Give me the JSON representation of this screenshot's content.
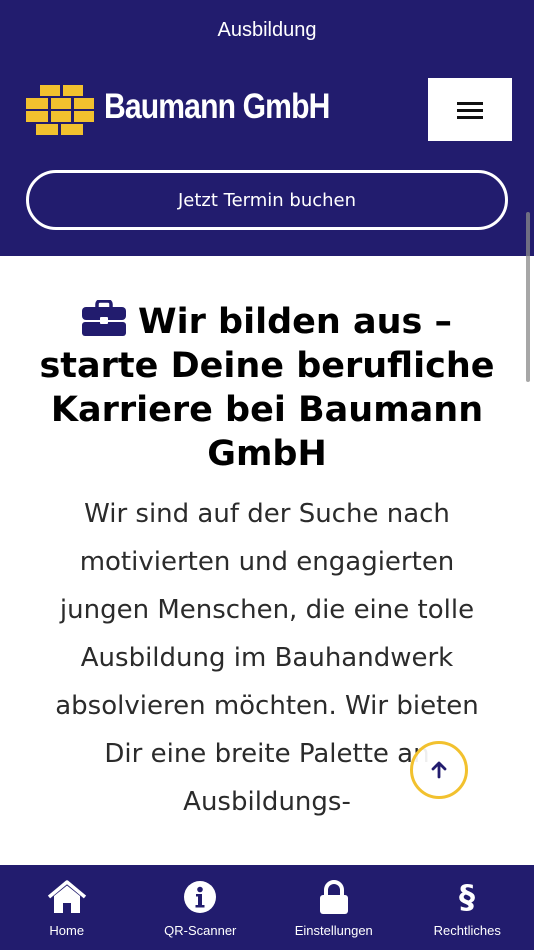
{
  "app": {
    "title": "Ausbildung",
    "brand": "Baumann GmbH"
  },
  "header": {
    "cta_label": "Jetzt Termin buchen",
    "menu_icon": "hamburger-icon"
  },
  "main": {
    "heading_icon": "briefcase-icon",
    "heading": "Wir bilden aus – starte Deine berufliche Karriere bei Baumann GmbH",
    "paragraph": "Wir sind auf der Suche nach motivierten und engagierten jungen Menschen, die eine tolle Ausbildung im Bauhandwerk absolvieren möchten. Wir bieten Dir eine breite Palette an Ausbildungs-"
  },
  "scroll_top": {
    "icon": "arrow-up-icon"
  },
  "tabbar": {
    "items": [
      {
        "label": "Home",
        "icon": "home-icon"
      },
      {
        "label": "QR-Scanner",
        "icon": "info-icon"
      },
      {
        "label": "Einstellungen",
        "icon": "lock-icon"
      },
      {
        "label": "Rechtliches",
        "icon": "section-sign-icon"
      }
    ]
  },
  "colors": {
    "primary": "#221c6e",
    "accent": "#f2c12e",
    "text": "#000000",
    "background": "#ffffff"
  }
}
